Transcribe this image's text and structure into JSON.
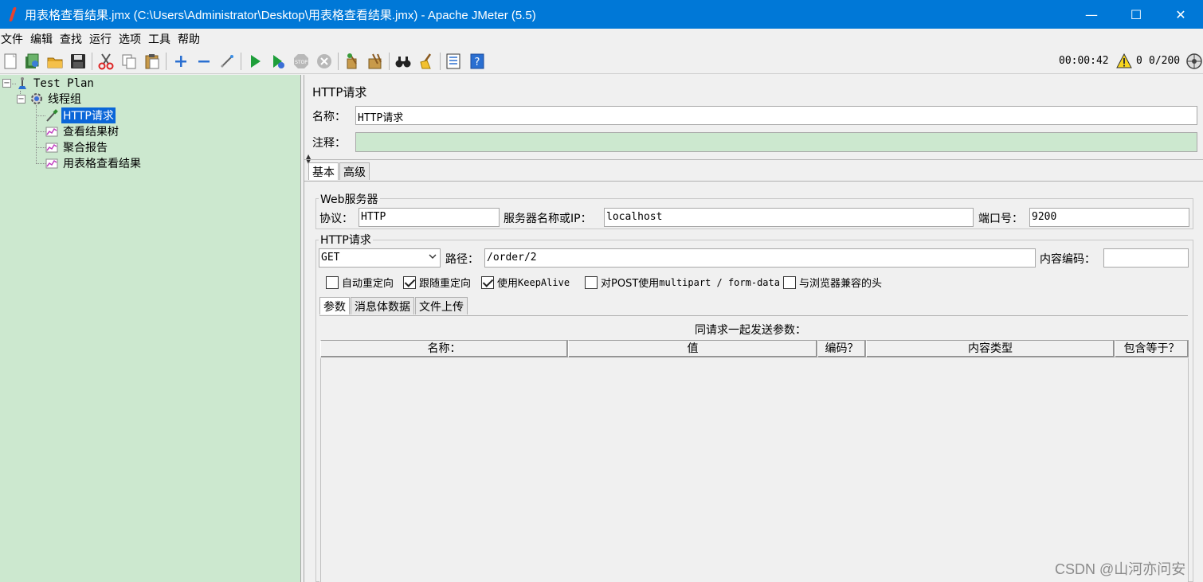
{
  "window": {
    "title": "用表格查看结果.jmx (C:\\Users\\Administrator\\Desktop\\用表格查看结果.jmx) - Apache JMeter (5.5)",
    "minimize": "—",
    "maximize": "☐",
    "close": "✕"
  },
  "menu": [
    "文件",
    "编辑",
    "查找",
    "运行",
    "选项",
    "工具",
    "帮助"
  ],
  "status": {
    "timer": "00:00:42",
    "errors": "0",
    "threads": "0/200"
  },
  "tree": {
    "test_plan": "Test Plan",
    "thread_group": "线程组",
    "http_request": "HTTP请求",
    "view_results_tree": "查看结果树",
    "aggregate_report": "聚合报告",
    "view_results_table": "用表格查看结果"
  },
  "panel": {
    "title": "HTTP请求",
    "name_label": "名称：",
    "name_value": "HTTP请求",
    "comment_label": "注释：",
    "comment_value": "",
    "tabs": [
      "基本",
      "高级"
    ]
  },
  "web_server": {
    "group_label": "Web服务器",
    "protocol_label": "协议：",
    "protocol_value": "HTTP",
    "server_label": "服务器名称或IP：",
    "server_value": "localhost",
    "port_label": "端口号：",
    "port_value": "9200"
  },
  "http_request": {
    "group_label": "HTTP请求",
    "method": "GET",
    "path_label": "路径：",
    "path_value": "/order/2",
    "encoding_label": "内容编码：",
    "encoding_value": "",
    "checkboxes": [
      {
        "label": "自动重定向",
        "checked": false
      },
      {
        "label": "跟随重定向",
        "checked": true
      },
      {
        "label_prefix": "使用 ",
        "label_mono": "KeepAlive",
        "checked": true
      },
      {
        "label_prefix": "对POST使用",
        "label_mono": "multipart / form-data",
        "checked": false
      },
      {
        "label": "与浏览器兼容的头",
        "checked": false
      }
    ],
    "subtabs": [
      "参数",
      "消息体数据",
      "文件上传"
    ]
  },
  "params_table": {
    "caption": "同请求一起发送参数：",
    "columns": [
      "名称：",
      "值",
      "编码？",
      "内容类型",
      "包含等于？"
    ],
    "rows": []
  },
  "watermark": "CSDN @山河亦问安"
}
